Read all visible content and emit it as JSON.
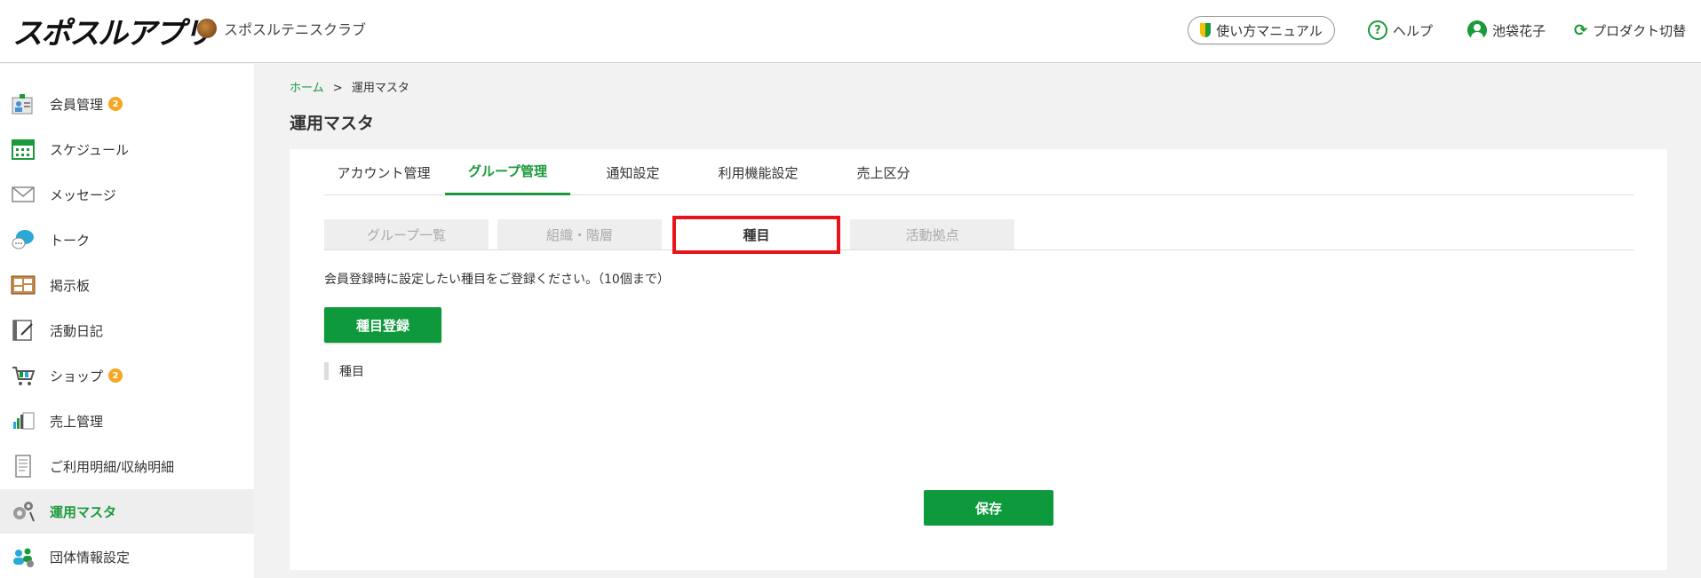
{
  "header": {
    "logo_text": "スポスルアプリ",
    "club_name": "スポスルテニスクラブ",
    "manual_label": "使い方マニュアル",
    "help_label": "ヘルプ",
    "user_name": "池袋花子",
    "product_switch_label": "プロダクト切替"
  },
  "sidebar": {
    "items": [
      {
        "label": "会員管理",
        "badge": "2",
        "icon": "members-icon"
      },
      {
        "label": "スケジュール",
        "icon": "calendar-icon"
      },
      {
        "label": "メッセージ",
        "icon": "envelope-icon"
      },
      {
        "label": "トーク",
        "icon": "chat-bubble-icon"
      },
      {
        "label": "掲示板",
        "icon": "bulletin-board-icon"
      },
      {
        "label": "活動日記",
        "icon": "diary-icon"
      },
      {
        "label": "ショップ",
        "badge": "2",
        "icon": "cart-icon"
      },
      {
        "label": "売上管理",
        "icon": "sales-chart-icon"
      },
      {
        "label": "ご利用明細/収納明細",
        "icon": "statement-icon"
      },
      {
        "label": "運用マスタ",
        "icon": "gears-icon",
        "active": true
      },
      {
        "label": "団体情報設定",
        "icon": "group-settings-icon"
      }
    ]
  },
  "breadcrumb": {
    "home": "ホーム",
    "separator": ">",
    "current": "運用マスタ"
  },
  "page_title": "運用マスタ",
  "tabs": [
    {
      "label": "アカウント管理"
    },
    {
      "label": "グループ管理",
      "active": true
    },
    {
      "label": "通知設定"
    },
    {
      "label": "利用機能設定"
    },
    {
      "label": "売上区分"
    }
  ],
  "subtabs": [
    {
      "label": "グループ一覧"
    },
    {
      "label": "組織・階層"
    },
    {
      "label": "種目",
      "active": true
    },
    {
      "label": "活動拠点"
    }
  ],
  "description": "会員登録時に設定したい種目をご登録ください。（10個まで）",
  "register_button": "種目登録",
  "field_label": "種目",
  "save_button": "保存",
  "colors": {
    "accent": "#1a9a3a",
    "button": "#0e9a3c",
    "highlight": "#e8141c",
    "badge": "#f5a623"
  }
}
